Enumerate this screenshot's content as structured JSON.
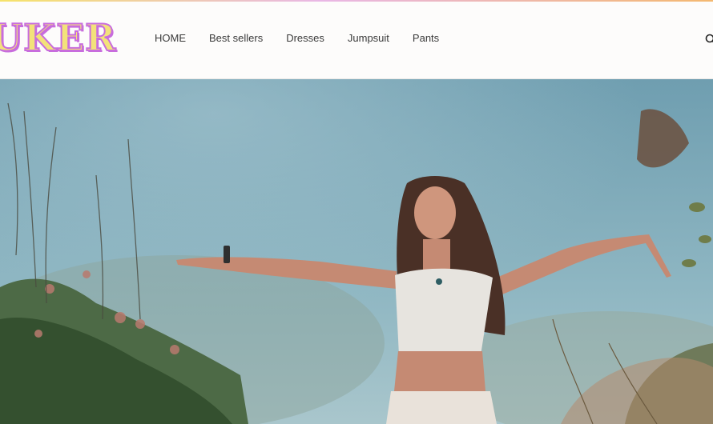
{
  "header": {
    "logo_text": "UKER",
    "nav": [
      "HOME",
      "Best sellers",
      "Dresses",
      "Jumpsuit",
      "Pants"
    ]
  },
  "icons": {
    "search": "search-icon"
  },
  "colors": {
    "logo_fill": "#f3e27a",
    "logo_outline": "#c86ddd",
    "sky": "#7aa6b6"
  }
}
